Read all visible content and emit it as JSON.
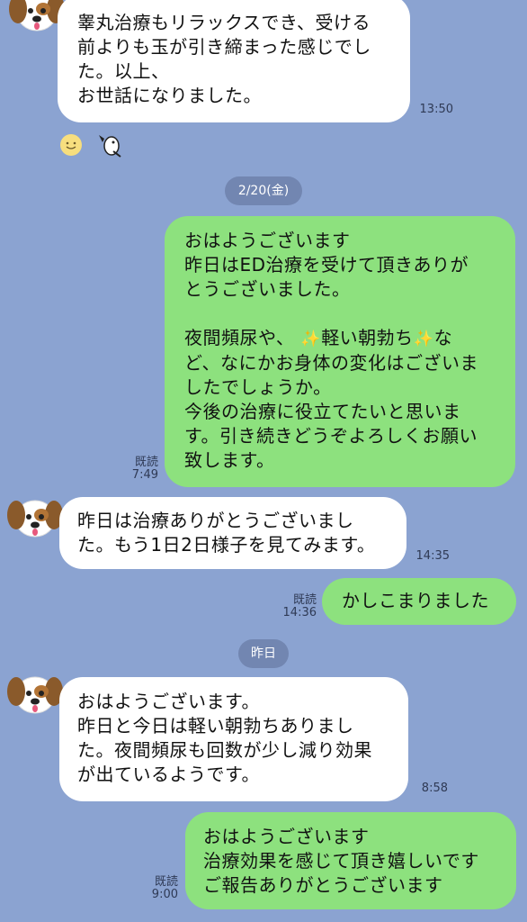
{
  "messages": [
    {
      "lines": [
        "睾丸治療もリラックスでき、受ける",
        "前よりも玉が引き締まった感じでし",
        "た。以上、",
        "お世話になりました。"
      ],
      "time": "13:50"
    },
    {
      "lines": [
        "おはようございます",
        "昨日はED治療を受けて頂きありが",
        "とうございました。"
      ],
      "lines2a": "夜間頻尿や、",
      "sparkle": "✨",
      "lines2b": "軽い朝勃ち",
      "lines2c": "な",
      "lines3": [
        "ど、なにかお身体の変化はございま",
        "したでしょうか。",
        "今後の治療に役立てたいと思いま",
        "す。引き続きどうぞよろしくお願い",
        "致します。"
      ],
      "read": "既読",
      "time": "7:49"
    },
    {
      "lines": [
        "昨日は治療ありがとうございまし",
        "た。もう1日2日様子を見てみます。"
      ],
      "time": "14:35"
    },
    {
      "lines": [
        "かしこまりました"
      ],
      "read": "既読",
      "time": "14:36"
    },
    {
      "lines": [
        "おはようございます。",
        "昨日と今日は軽い朝勃ちありまし",
        "た。夜間頻尿も回数が少し減り効果",
        "が出ているようです。"
      ],
      "time": "8:58"
    },
    {
      "lines": [
        "おはようございます",
        "治療効果を感じて頂き嬉しいです",
        "ご報告ありがとうございます"
      ],
      "read": "既読",
      "time": "9:00"
    }
  ],
  "dates": {
    "first": "2/20(金)",
    "second": "昨日"
  },
  "icons": {
    "avatar": "dog-avatar-icon",
    "emoji": "smile-emoji-icon",
    "sticker": "bird-sticker-icon",
    "sparkle": "sparkle-icon"
  },
  "colors": {
    "background": "#8ba3d1",
    "incoming": "#ffffff",
    "outgoing": "#8de17e",
    "date_pill": "#7286b1"
  }
}
